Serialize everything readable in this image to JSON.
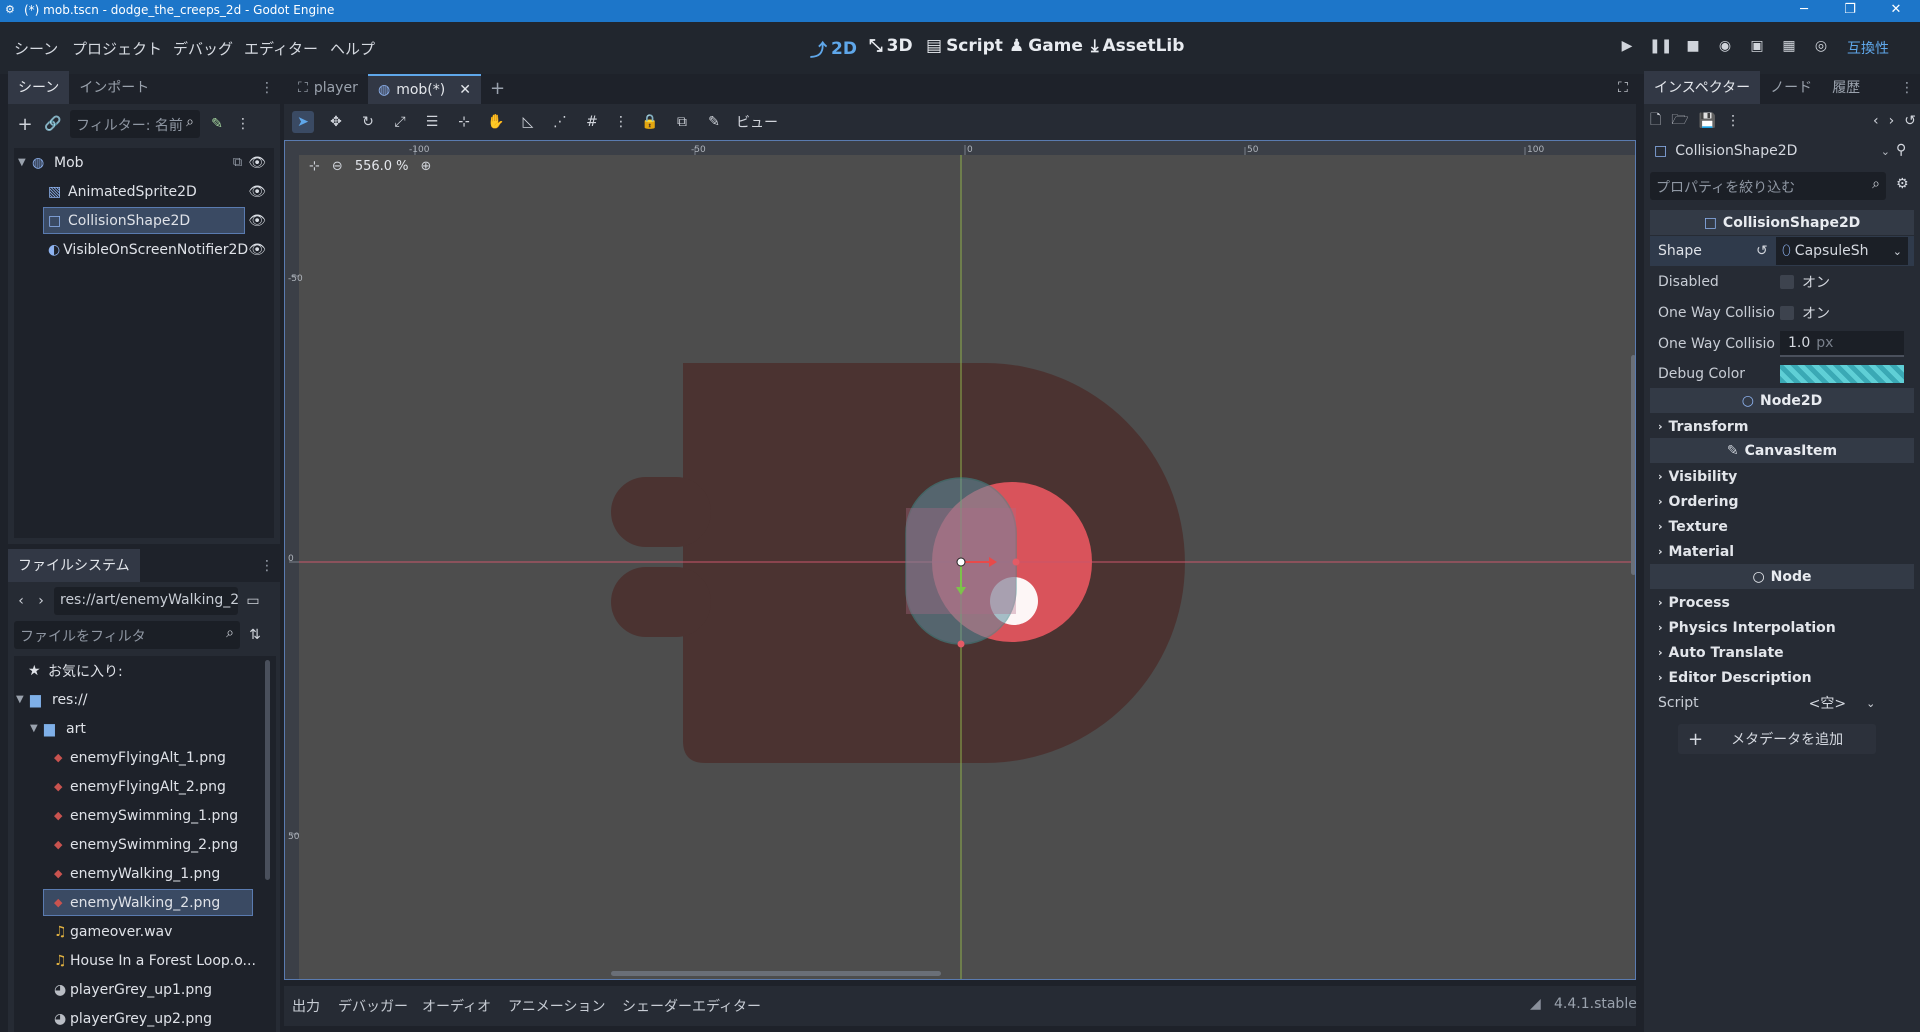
{
  "window": {
    "title": "(*) mob.tscn - dodge_the_creeps_2d - Godot Engine",
    "controls": [
      "─",
      "❐",
      "✕"
    ]
  },
  "menu": [
    "シーン",
    "プロジェクト",
    "デバッグ",
    "エディター",
    "ヘルプ"
  ],
  "main_tabs": [
    {
      "label": "2D",
      "icon": "2d-icon",
      "active": true
    },
    {
      "label": "3D",
      "icon": "3d-icon",
      "active": false
    },
    {
      "label": "Script",
      "icon": "script-icon",
      "active": false
    },
    {
      "label": "Game",
      "icon": "game-icon",
      "active": false
    },
    {
      "label": "AssetLib",
      "icon": "assetlib-icon",
      "active": false
    }
  ],
  "renderer": "互換性",
  "scene_dock": {
    "tabs": [
      "シーン",
      "インポート"
    ],
    "filter_placeholder": "フィルター: 名前",
    "nodes": [
      {
        "name": "Mob",
        "icon": "node2d-icon",
        "level": 0,
        "selected": false
      },
      {
        "name": "AnimatedSprite2D",
        "icon": "animated-sprite-icon",
        "level": 1,
        "selected": false
      },
      {
        "name": "CollisionShape2D",
        "icon": "collision-shape-icon",
        "level": 1,
        "selected": true
      },
      {
        "name": "VisibleOnScreenNotifier2D",
        "icon": "notifier-icon",
        "level": 1,
        "selected": false
      }
    ]
  },
  "filesystem_dock": {
    "title": "ファイルシステム",
    "path": "res://art/enemyWalking_2.",
    "filter_placeholder": "ファイルをフィルタ",
    "items": [
      {
        "label": "お気に入り:",
        "icon": "star-icon",
        "indent": 0,
        "selected": false
      },
      {
        "label": "res://",
        "icon": "folder-icon",
        "indent": 0,
        "selected": false
      },
      {
        "label": "art",
        "icon": "folder-icon",
        "indent": 1,
        "selected": false
      },
      {
        "label": "enemyFlyingAlt_1.png",
        "icon": "image-icon",
        "indent": 2,
        "selected": false
      },
      {
        "label": "enemyFlyingAlt_2.png",
        "icon": "image-icon",
        "indent": 2,
        "selected": false
      },
      {
        "label": "enemySwimming_1.png",
        "icon": "image-icon",
        "indent": 2,
        "selected": false
      },
      {
        "label": "enemySwimming_2.png",
        "icon": "image-icon",
        "indent": 2,
        "selected": false
      },
      {
        "label": "enemyWalking_1.png",
        "icon": "image-icon",
        "indent": 2,
        "selected": false
      },
      {
        "label": "enemyWalking_2.png",
        "icon": "image-icon",
        "indent": 2,
        "selected": true
      },
      {
        "label": "gameover.wav",
        "icon": "audio-icon",
        "indent": 2,
        "selected": false
      },
      {
        "label": "House In a Forest Loop.o...",
        "icon": "audio-icon",
        "indent": 2,
        "selected": false
      },
      {
        "label": "playerGrey_up1.png",
        "icon": "image-icon",
        "indent": 2,
        "selected": false
      },
      {
        "label": "playerGrey_up2.png",
        "icon": "image-icon",
        "indent": 2,
        "selected": false
      }
    ]
  },
  "editor_tabs": [
    {
      "label": "player",
      "active": false
    },
    {
      "label": "mob(*)",
      "active": true
    }
  ],
  "toolbar": {
    "view_label": "ビュー"
  },
  "viewport": {
    "zoom": "556.0 %",
    "ruler_top": [
      "-100",
      "-50",
      "0",
      "50",
      "100"
    ],
    "ruler_left": [
      "-50",
      "0",
      "50"
    ]
  },
  "bottom_tabs": [
    "出力",
    "デバッガー",
    "オーディオ",
    "アニメーション",
    "シェーダーエディター"
  ],
  "version": "4.4.1.stable",
  "inspector": {
    "tabs": [
      "インスペクター",
      "ノード",
      "履歴"
    ],
    "object": "CollisionShape2D",
    "filter_placeholder": "プロパティを絞り込む",
    "class_header": "CollisionShape2D",
    "properties": [
      {
        "name": "Shape",
        "value": "CapsuleSh"
      },
      {
        "name": "Disabled",
        "value": "オン"
      },
      {
        "name": "One Way Collisio",
        "value": "オン"
      },
      {
        "name": "One Way Collisio",
        "value": "1.0",
        "unit": "px"
      },
      {
        "name": "Debug Color",
        "value": ""
      }
    ],
    "node2d_header": "Node2D",
    "node2d_groups": [
      "Transform"
    ],
    "canvas_header": "CanvasItem",
    "canvas_groups": [
      "Visibility",
      "Ordering",
      "Texture",
      "Material"
    ],
    "node_header": "Node",
    "node_groups": [
      "Process",
      "Physics Interpolation",
      "Auto Translate",
      "Editor Description"
    ],
    "script_label": "Script",
    "script_value": "<空>",
    "add_metadata": "メタデータを追加"
  },
  "colors": {
    "accent": "#5fa7ea",
    "titlebar": "#1d76c9",
    "viewport_bg": "#4d4d4d",
    "sprite_body": "#4b3331",
    "sprite_eye": "#d9535b",
    "collision_fill": "#6c8a9c"
  }
}
